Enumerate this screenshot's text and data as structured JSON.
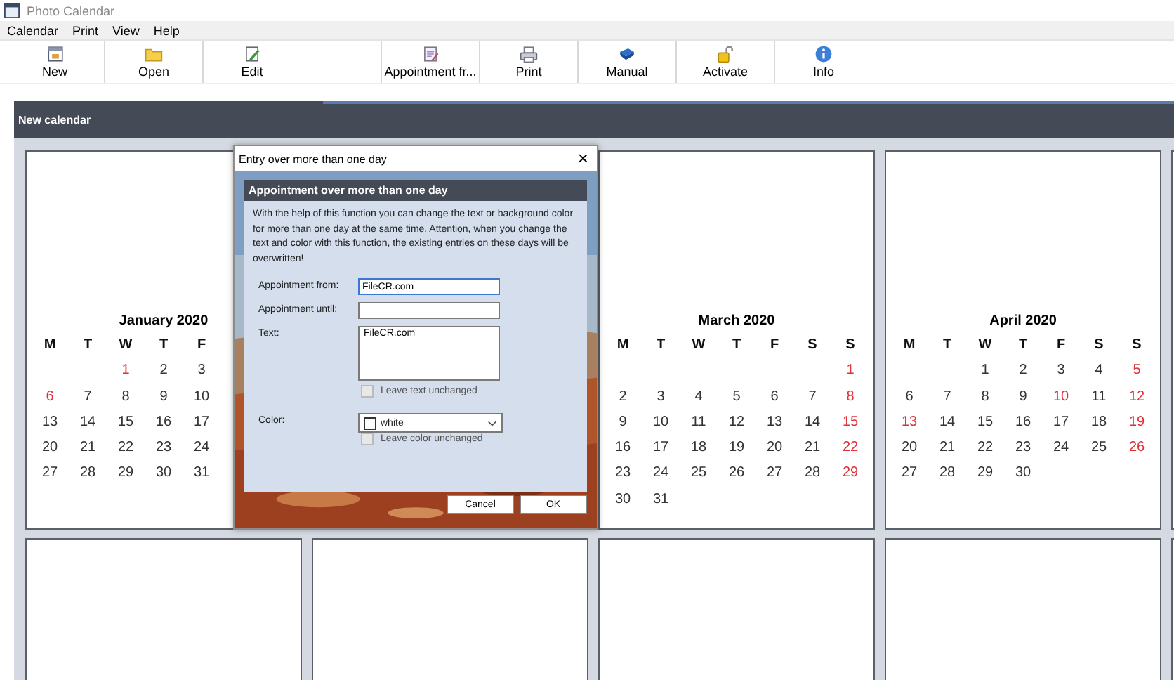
{
  "window": {
    "title": "Photo Calendar"
  },
  "menu": [
    "Calendar",
    "Print",
    "View",
    "Help"
  ],
  "toolbar": [
    "New",
    "Open",
    "Edit",
    "Appointment fr...",
    "Print",
    "Manual",
    "Activate",
    "Info"
  ],
  "calendar_header": "New calendar",
  "months": [
    {
      "title": "January 2020",
      "weekdays": [
        "M",
        "T",
        "W",
        "T",
        "F"
      ],
      "weeks": [
        {
          "days": [
            {
              "day": "1",
              "red": true
            },
            {
              "day": "2",
              "red": false
            },
            {
              "day": "3",
              "red": false
            }
          ]
        },
        {
          "days": [
            {
              "day": "6",
              "red": true
            },
            {
              "day": "7",
              "red": false
            },
            {
              "day": "8",
              "red": false
            },
            {
              "day": "9",
              "red": false
            },
            {
              "day": "10",
              "red": false
            }
          ]
        },
        {
          "days": [
            {
              "day": "13",
              "red": false
            },
            {
              "day": "14",
              "red": false
            },
            {
              "day": "15",
              "red": false
            },
            {
              "day": "16",
              "red": false
            },
            {
              "day": "17",
              "red": false
            }
          ]
        },
        {
          "days": [
            {
              "day": "20",
              "red": false
            },
            {
              "day": "21",
              "red": false
            },
            {
              "day": "22",
              "red": false
            },
            {
              "day": "23",
              "red": false
            },
            {
              "day": "24",
              "red": false
            }
          ]
        },
        {
          "days": [
            {
              "day": "27",
              "red": false
            },
            {
              "day": "28",
              "red": false
            },
            {
              "day": "29",
              "red": false
            },
            {
              "day": "30",
              "red": false
            },
            {
              "day": "31",
              "red": false
            }
          ]
        }
      ]
    },
    {
      "title": "March 2020",
      "weekdays": [
        "M",
        "T",
        "W",
        "T",
        "F",
        "S",
        "S"
      ],
      "weeks": [
        {
          "days": [
            {
              "day": "1",
              "red": true
            }
          ]
        },
        {
          "days": [
            {
              "day": "2",
              "red": false
            },
            {
              "day": "3",
              "red": false
            },
            {
              "day": "4",
              "red": false
            },
            {
              "day": "5",
              "red": false
            },
            {
              "day": "6",
              "red": false
            },
            {
              "day": "7",
              "red": false
            },
            {
              "day": "8",
              "red": true
            }
          ]
        },
        {
          "days": [
            {
              "day": "9",
              "red": false
            },
            {
              "day": "10",
              "red": false
            },
            {
              "day": "11",
              "red": false
            },
            {
              "day": "12",
              "red": false
            },
            {
              "day": "13",
              "red": false
            },
            {
              "day": "14",
              "red": false
            },
            {
              "day": "15",
              "red": true
            }
          ]
        },
        {
          "days": [
            {
              "day": "16",
              "red": false
            },
            {
              "day": "17",
              "red": false
            },
            {
              "day": "18",
              "red": false
            },
            {
              "day": "19",
              "red": false
            },
            {
              "day": "20",
              "red": false
            },
            {
              "day": "21",
              "red": false
            },
            {
              "day": "22",
              "red": true
            }
          ]
        },
        {
          "days": [
            {
              "day": "23",
              "red": false
            },
            {
              "day": "24",
              "red": false
            },
            {
              "day": "25",
              "red": false
            },
            {
              "day": "26",
              "red": false
            },
            {
              "day": "27",
              "red": false
            },
            {
              "day": "28",
              "red": false
            },
            {
              "day": "29",
              "red": true
            }
          ]
        },
        {
          "days": [
            {
              "day": "30",
              "red": false
            },
            {
              "day": "31",
              "red": false
            }
          ]
        }
      ]
    },
    {
      "title": "April 2020",
      "weekdays": [
        "M",
        "T",
        "W",
        "T",
        "F",
        "S",
        "S"
      ],
      "weeks": [
        {
          "days": [
            {
              "day": "1",
              "red": false
            },
            {
              "day": "2",
              "red": false
            },
            {
              "day": "3",
              "red": false
            },
            {
              "day": "4",
              "red": false
            },
            {
              "day": "5",
              "red": true
            }
          ]
        },
        {
          "days": [
            {
              "day": "6",
              "red": false
            },
            {
              "day": "7",
              "red": false
            },
            {
              "day": "8",
              "red": false
            },
            {
              "day": "9",
              "red": false
            },
            {
              "day": "10",
              "red": true
            },
            {
              "day": "11",
              "red": false
            },
            {
              "day": "12",
              "red": true
            }
          ]
        },
        {
          "days": [
            {
              "day": "13",
              "red": true
            },
            {
              "day": "14",
              "red": false
            },
            {
              "day": "15",
              "red": false
            },
            {
              "day": "16",
              "red": false
            },
            {
              "day": "17",
              "red": false
            },
            {
              "day": "18",
              "red": false
            },
            {
              "day": "19",
              "red": true
            }
          ]
        },
        {
          "days": [
            {
              "day": "20",
              "red": false
            },
            {
              "day": "21",
              "red": false
            },
            {
              "day": "22",
              "red": false
            },
            {
              "day": "23",
              "red": false
            },
            {
              "day": "24",
              "red": false
            },
            {
              "day": "25",
              "red": false
            },
            {
              "day": "26",
              "red": true
            }
          ]
        },
        {
          "days": [
            {
              "day": "27",
              "red": false
            },
            {
              "day": "28",
              "red": false
            },
            {
              "day": "29",
              "red": false
            },
            {
              "day": "30",
              "red": false
            }
          ]
        }
      ]
    }
  ],
  "dialog": {
    "title": "Entry over more than one day",
    "close": "×",
    "header": "Appointment over more than one day",
    "description": "With the help of this function you can change the text or background color for more than one day at the same time. Attention, when you change the text and color with this function, the existing entries on these days will be overwritten!",
    "fields": [
      {
        "kind": "input",
        "label": "Appointment from:",
        "value": "FileCR.com",
        "focused": true
      },
      {
        "kind": "input",
        "label": "Appointment until:",
        "focused": false
      },
      {
        "kind": "textarea",
        "label": "Text:",
        "value": "FileCR.com",
        "focused": false
      },
      {
        "kind": "checkbox",
        "label": "Leave text unchanged",
        "checked": false,
        "disabled": true
      },
      {
        "kind": "select",
        "label": "Color:",
        "value": "white",
        "color": "#ffffff"
      },
      {
        "kind": "checkbox",
        "label": "Leave color unchanged",
        "checked": false,
        "disabled": true
      }
    ],
    "buttons": [
      "Cancel",
      "OK"
    ]
  }
}
